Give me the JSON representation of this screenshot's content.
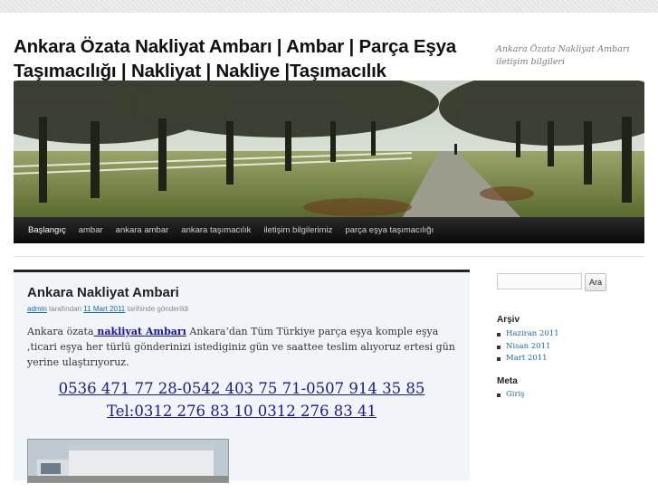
{
  "header": {
    "site_title": "Ankara Özata Nakliyat Ambarı | Ambar | Parça Eşya Taşımacılığı | Nakliyat | Nakliye |Taşımacılık",
    "site_description": "Ankara Özata Nakliyat Ambarı iletişim bilgileri"
  },
  "nav": {
    "items": [
      {
        "label": "Başlangıç"
      },
      {
        "label": "ambar"
      },
      {
        "label": "ankara ambar"
      },
      {
        "label": "ankara taşımacılık"
      },
      {
        "label": "iletişim bilgilerimiz"
      },
      {
        "label": "parça eşya taşımacılığı"
      }
    ]
  },
  "post": {
    "title": "Ankara Nakliyat Ambari",
    "meta_author": "admin",
    "meta_by": "tarafından",
    "meta_date": "11 Mart 2011",
    "meta_suffix": "tarihinde gönderildi",
    "body_prefix": "Ankara özata",
    "body_link": " nakliyat Ambarı",
    "body_suffix": " Ankara’dan Tüm Türkiye parça eşya komple eşya ,ticari eşya her türlü gönderinizi istediginiz gün ve saattee teslim alıyoruz ertesi gün yerine ulaştırıyoruz.",
    "phones_line1": "0536 471 77 28-0542 403 75 71-0507 914 35 85",
    "phones_line2": "Tel:0312 276 83 10 0312 276 83 41"
  },
  "sidebar": {
    "search_button": "Ara",
    "archive_title": "Arşiv",
    "archive_items": [
      {
        "label": "Haziran 2011"
      },
      {
        "label": "Nisan 2011"
      },
      {
        "label": "Mart 2011"
      }
    ],
    "meta_title": "Meta",
    "meta_items": [
      {
        "label": "Giriş"
      }
    ]
  },
  "colors": {
    "nav_background": "#111111",
    "link": "#1b6aa5",
    "phone_text": "#1a1a8c",
    "post_background": "#f1f5fa"
  }
}
